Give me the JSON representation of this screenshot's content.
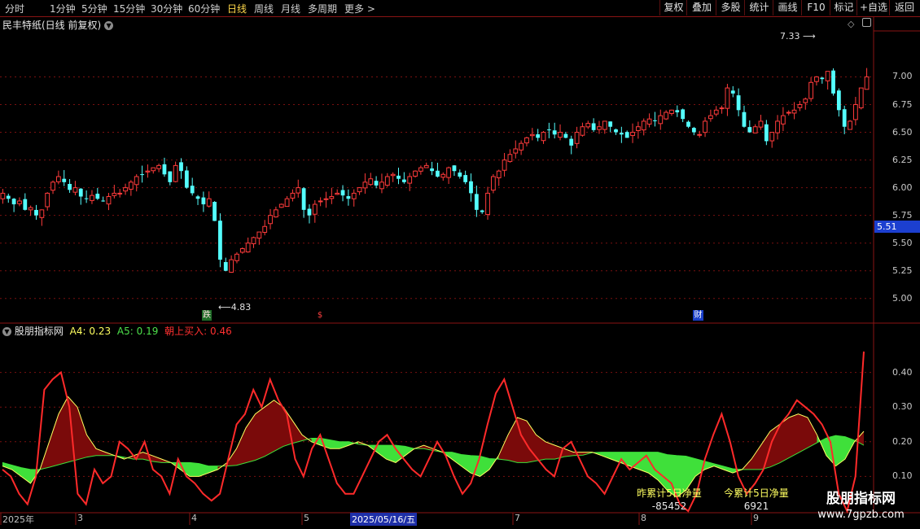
{
  "toolbar": {
    "periods": [
      "分时",
      "1分钟",
      "5分钟",
      "15分钟",
      "30分钟",
      "60分钟",
      "日线",
      "周线",
      "月线",
      "多周期",
      "更多"
    ],
    "active_period": "日线",
    "buttons": [
      "复权",
      "叠加",
      "多股",
      "统计",
      "画线",
      "F10",
      "标记",
      "+自选",
      "返回"
    ]
  },
  "main_panel": {
    "title": "民丰特纸(日线 前复权)",
    "high_label": "7.33",
    "low_label": "4.83",
    "current_price_tag": "5.51",
    "markers": [
      "跌",
      "$",
      "财"
    ]
  },
  "indicator_panel": {
    "name": "股朋指标网",
    "a4_label": "A4: 0.23",
    "a5_label": "A5: 0.19",
    "buy_label": "朝上买入: 0.46",
    "net_yesterday_title": "昨累计5日净量",
    "net_yesterday_value": "-85452",
    "net_today_title": "今累计5日净量",
    "net_today_value": "6921"
  },
  "x_axis_labels": [
    "2025年",
    "3",
    "4",
    "5",
    "2025/05/16/五",
    "7",
    "8",
    "9"
  ],
  "watermark": {
    "title": "股朋指标网",
    "url": "www.7gpzb.com"
  },
  "colors": {
    "up": "#ff3b3b",
    "down": "#54ffff",
    "green_fill": "#3fe03a",
    "red_fill": "#7a0a0a",
    "line": "#ff2a2a",
    "yellow": "#ffff60"
  },
  "chart_data": [
    {
      "type": "candlestick",
      "title": "民丰特纸(日线 前复权)",
      "ylim": [
        4.8,
        7.4
      ],
      "yticks": [
        5.0,
        5.25,
        5.5,
        5.75,
        6.0,
        6.25,
        6.5,
        6.75,
        7.0
      ],
      "close": [
        5.95,
        5.9,
        5.85,
        5.88,
        5.8,
        5.82,
        5.75,
        5.8,
        5.95,
        6.05,
        6.1,
        6.05,
        5.98,
        6.0,
        5.92,
        5.9,
        5.93,
        5.9,
        5.88,
        5.92,
        5.95,
        5.95,
        6.0,
        6.05,
        6.1,
        6.12,
        6.15,
        6.18,
        6.2,
        6.12,
        6.05,
        6.2,
        6.15,
        6.0,
        5.95,
        5.9,
        5.85,
        5.9,
        5.7,
        5.35,
        5.25,
        5.35,
        5.4,
        5.45,
        5.5,
        5.55,
        5.6,
        5.65,
        5.75,
        5.8,
        5.85,
        5.9,
        5.95,
        6.0,
        5.8,
        5.75,
        5.85,
        5.88,
        5.9,
        5.92,
        5.95,
        5.93,
        5.9,
        5.95,
        6.0,
        6.05,
        6.08,
        6.02,
        6.05,
        6.1,
        6.12,
        6.08,
        6.05,
        6.1,
        6.15,
        6.18,
        6.2,
        6.15,
        6.1,
        6.12,
        6.18,
        6.15,
        6.1,
        6.05,
        5.95,
        5.8,
        5.78,
        5.95,
        6.1,
        6.15,
        6.25,
        6.3,
        6.35,
        6.4,
        6.45,
        6.48,
        6.45,
        6.5,
        6.52,
        6.48,
        6.5,
        6.45,
        6.38,
        6.5,
        6.55,
        6.58,
        6.52,
        6.55,
        6.6,
        6.55,
        6.5,
        6.48,
        6.45,
        6.5,
        6.55,
        6.6,
        6.62,
        6.6,
        6.65,
        6.68,
        6.7,
        6.68,
        6.62,
        6.55,
        6.5,
        6.48,
        6.6,
        6.65,
        6.7,
        6.72,
        6.9,
        6.85,
        6.7,
        6.55,
        6.5,
        6.55,
        6.6,
        6.42,
        6.5,
        6.6,
        6.65,
        6.68,
        6.7,
        6.75,
        6.8,
        6.95,
        7.0,
        6.98,
        7.05,
        6.85,
        6.7,
        6.55,
        6.6,
        6.75,
        6.9,
        7.0
      ],
      "x_ticks": [
        "2025年",
        "3",
        "4",
        "5",
        "2025/05/16/五",
        "7",
        "8",
        "9"
      ],
      "annotations": [
        "7.33",
        "4.83",
        "5.51"
      ]
    },
    {
      "type": "line",
      "name": "股朋指标网",
      "ylim": [
        0,
        0.5
      ],
      "yticks": [
        0.1,
        0.2,
        0.3,
        0.4
      ],
      "series": [
        {
          "name": "朝上买入",
          "values": [
            0.12,
            0.1,
            0.05,
            0.02,
            0.1,
            0.35,
            0.38,
            0.4,
            0.3,
            0.05,
            0.02,
            0.12,
            0.08,
            0.1,
            0.2,
            0.18,
            0.15,
            0.2,
            0.12,
            0.1,
            0.05,
            0.15,
            0.1,
            0.08,
            0.05,
            0.03,
            0.05,
            0.15,
            0.25,
            0.28,
            0.35,
            0.3,
            0.38,
            0.32,
            0.28,
            0.15,
            0.1,
            0.18,
            0.22,
            0.15,
            0.08,
            0.05,
            0.05,
            0.1,
            0.15,
            0.2,
            0.22,
            0.18,
            0.15,
            0.12,
            0.1,
            0.15,
            0.2,
            0.16,
            0.1,
            0.05,
            0.08,
            0.15,
            0.25,
            0.34,
            0.38,
            0.3,
            0.22,
            0.18,
            0.15,
            0.12,
            0.1,
            0.18,
            0.2,
            0.15,
            0.1,
            0.08,
            0.05,
            0.1,
            0.15,
            0.12,
            0.14,
            0.16,
            0.12,
            0.1,
            0.08,
            0.02,
            0.0,
            0.05,
            0.15,
            0.22,
            0.28,
            0.2,
            0.1,
            0.05,
            0.08,
            0.12,
            0.2,
            0.25,
            0.28,
            0.32,
            0.3,
            0.28,
            0.25,
            0.2,
            0.05,
            0.0,
            0.1,
            0.46
          ]
        },
        {
          "name": "A4",
          "values": [
            0.13,
            0.12,
            0.1,
            0.08,
            0.12,
            0.2,
            0.28,
            0.33,
            0.3,
            0.22,
            0.18,
            0.17,
            0.16,
            0.15,
            0.16,
            0.17,
            0.16,
            0.15,
            0.14,
            0.12,
            0.1,
            0.1,
            0.11,
            0.12,
            0.14,
            0.18,
            0.24,
            0.28,
            0.3,
            0.32,
            0.3,
            0.26,
            0.22,
            0.2,
            0.19,
            0.18,
            0.18,
            0.19,
            0.2,
            0.19,
            0.17,
            0.15,
            0.14,
            0.16,
            0.18,
            0.19,
            0.18,
            0.17,
            0.15,
            0.13,
            0.11,
            0.1,
            0.12,
            0.16,
            0.22,
            0.27,
            0.26,
            0.22,
            0.2,
            0.19,
            0.18,
            0.17,
            0.17,
            0.17,
            0.16,
            0.15,
            0.14,
            0.13,
            0.12,
            0.11,
            0.09,
            0.06,
            0.04,
            0.06,
            0.1,
            0.12,
            0.13,
            0.12,
            0.11,
            0.12,
            0.15,
            0.19,
            0.23,
            0.25,
            0.27,
            0.28,
            0.27,
            0.22,
            0.16,
            0.13,
            0.15,
            0.2,
            0.23
          ]
        },
        {
          "name": "A5",
          "values": [
            0.14,
            0.13,
            0.12,
            0.12,
            0.13,
            0.14,
            0.15,
            0.16,
            0.16,
            0.16,
            0.15,
            0.15,
            0.14,
            0.14,
            0.14,
            0.14,
            0.13,
            0.13,
            0.13,
            0.14,
            0.15,
            0.17,
            0.19,
            0.2,
            0.21,
            0.21,
            0.2,
            0.2,
            0.19,
            0.19,
            0.19,
            0.19,
            0.18,
            0.18,
            0.17,
            0.17,
            0.16,
            0.16,
            0.15,
            0.15,
            0.14,
            0.14,
            0.15,
            0.15,
            0.16,
            0.16,
            0.17,
            0.17,
            0.17,
            0.17,
            0.17,
            0.17,
            0.16,
            0.16,
            0.15,
            0.14,
            0.13,
            0.12,
            0.12,
            0.12,
            0.13,
            0.15,
            0.17,
            0.19,
            0.21,
            0.22,
            0.21,
            0.19
          ]
        }
      ]
    }
  ]
}
